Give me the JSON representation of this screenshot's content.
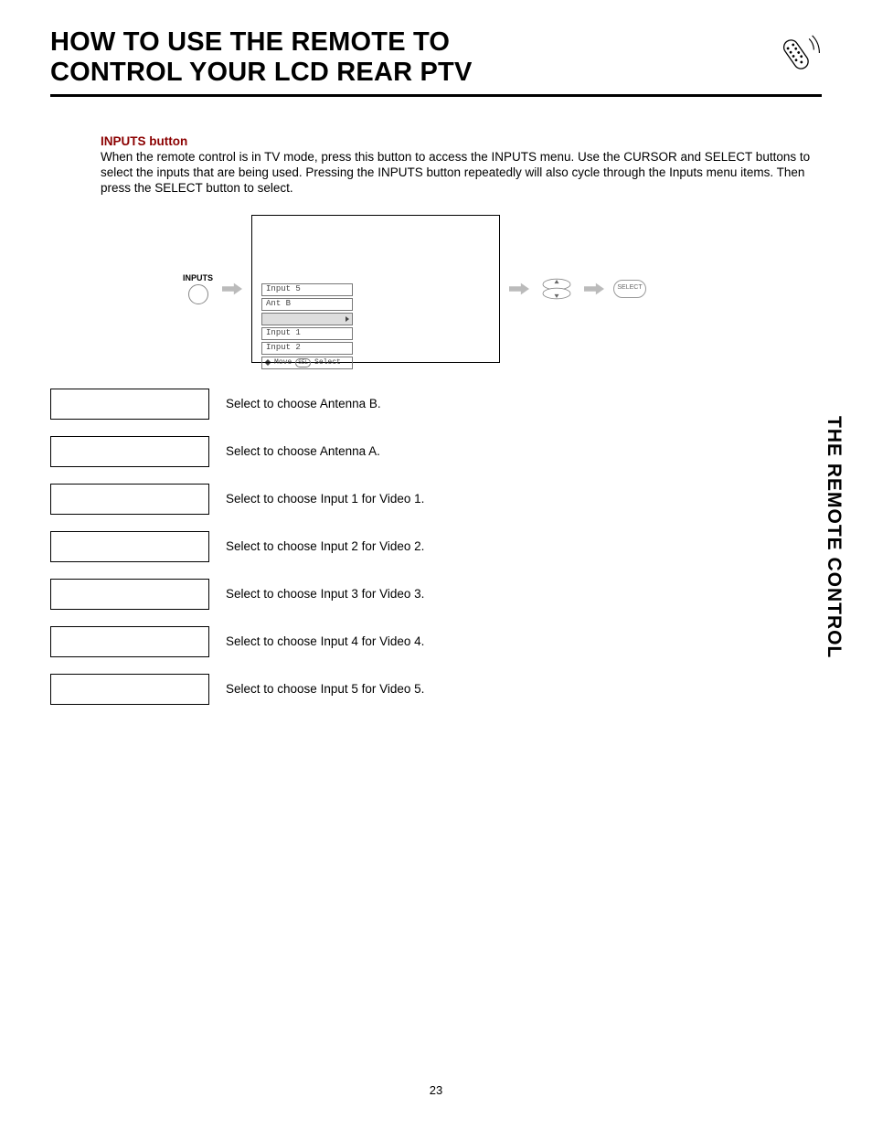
{
  "header": {
    "title_line1": "HOW TO USE THE REMOTE TO",
    "title_line2": "CONTROL YOUR LCD REAR PTV"
  },
  "side_tab": "THE REMOTE CONTROL",
  "page_number": "23",
  "section": {
    "heading": "INPUTS button",
    "body": "When the remote control is in TV mode, press this button to access the INPUTS menu.  Use the CURSOR and SELECT buttons to select the inputs that are being used.  Pressing the INPUTS button repeatedly will also cycle through the Inputs menu items.  Then press the SELECT button to select."
  },
  "flow": {
    "inputs_label": "INPUTS",
    "osd_items": [
      "Input 5",
      "Ant B",
      "",
      "Input 1",
      "Input 2"
    ],
    "osd_legend_move": "Move",
    "osd_legend_sel": "SEL",
    "osd_legend_select": "Select",
    "select_label": "SELECT",
    "selected_index": 2
  },
  "options": [
    {
      "desc": "Select to choose Antenna B."
    },
    {
      "desc": "Select to choose Antenna A."
    },
    {
      "desc": "Select to choose Input 1 for Video 1."
    },
    {
      "desc": "Select to choose Input 2 for Video 2."
    },
    {
      "desc": "Select to choose Input 3 for Video 3."
    },
    {
      "desc": "Select to choose Input 4 for Video 4."
    },
    {
      "desc": "Select to choose Input 5 for Video 5."
    }
  ]
}
